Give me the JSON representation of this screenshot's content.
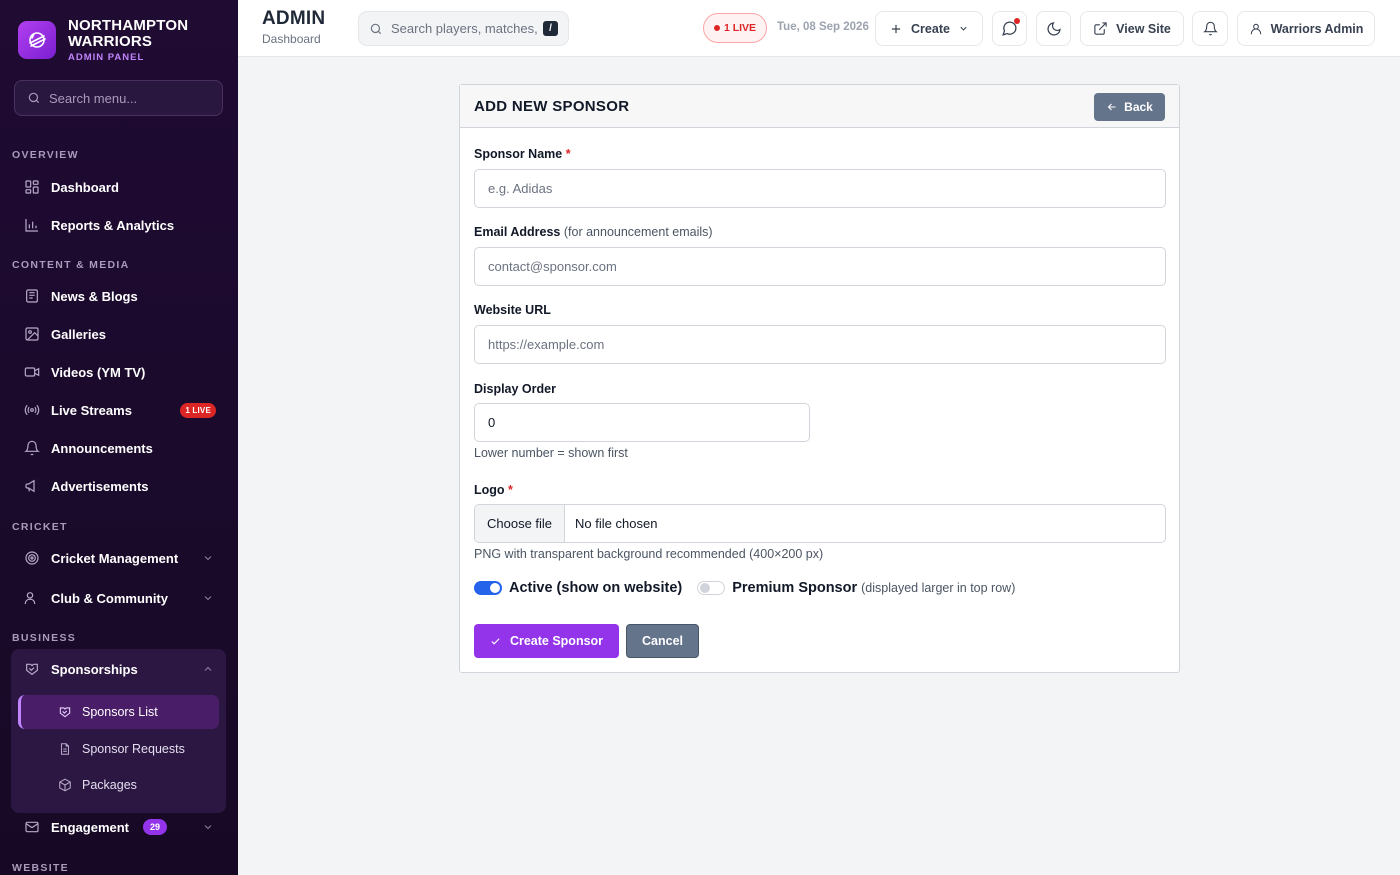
{
  "brand": {
    "name_line1": "NORTHAMPTON",
    "name_line2": "WARRIORS",
    "subtitle": "ADMIN PANEL"
  },
  "sidebar": {
    "search_placeholder": "Search menu...",
    "sections": {
      "overview": "OVERVIEW",
      "content": "CONTENT & MEDIA",
      "cricket": "CRICKET",
      "business": "BUSINESS",
      "website": "WEBSITE"
    },
    "items": {
      "dashboard": "Dashboard",
      "reports": "Reports & Analytics",
      "news": "News & Blogs",
      "galleries": "Galleries",
      "videos": "Videos (YM TV)",
      "live_streams": "Live Streams",
      "live_badge": "1 LIVE",
      "announcements": "Announcements",
      "advertisements": "Advertisements",
      "cricket_management": "Cricket Management",
      "club_community": "Club & Community",
      "sponsorships": "Sponsorships",
      "sponsors_list": "Sponsors List",
      "sponsor_requests": "Sponsor Requests",
      "packages": "Packages",
      "engagement": "Engagement",
      "engagement_count": "29"
    }
  },
  "topbar": {
    "title": "ADMIN",
    "subtitle": "Dashboard",
    "search_placeholder": "Search players, matches, n",
    "search_shortcut": "/",
    "live_label": "1 LIVE",
    "date": "Tue, 08 Sep 2026",
    "create_label": "Create",
    "view_site_label": "View Site",
    "user_label": "Warriors Admin"
  },
  "form": {
    "title": "ADD NEW SPONSOR",
    "back_label": "Back",
    "sponsor_name_label": "Sponsor Name",
    "required_mark": "*",
    "sponsor_name_placeholder": "e.g. Adidas",
    "email_label": "Email Address",
    "email_hint": "(for announcement emails)",
    "email_placeholder": "contact@sponsor.com",
    "website_label": "Website URL",
    "website_placeholder": "https://example.com",
    "display_order_label": "Display Order",
    "display_order_value": "0",
    "display_order_help": "Lower number = shown first",
    "logo_label": "Logo",
    "choose_file_label": "Choose file",
    "no_file_text": "No file chosen",
    "logo_help": "PNG with transparent background recommended (400×200 px)",
    "active_label": "Active (show on website)",
    "active_on": true,
    "premium_label": "Premium Sponsor",
    "premium_hint": "(displayed larger in top row)",
    "premium_on": false,
    "submit_label": "Create Sponsor",
    "cancel_label": "Cancel"
  },
  "colors": {
    "accent": "#9333ea",
    "sidebar_bg": "#1b0a2c",
    "live_red": "#dc2626",
    "toggle_on": "#2563eb",
    "muted_button": "#64748b"
  }
}
